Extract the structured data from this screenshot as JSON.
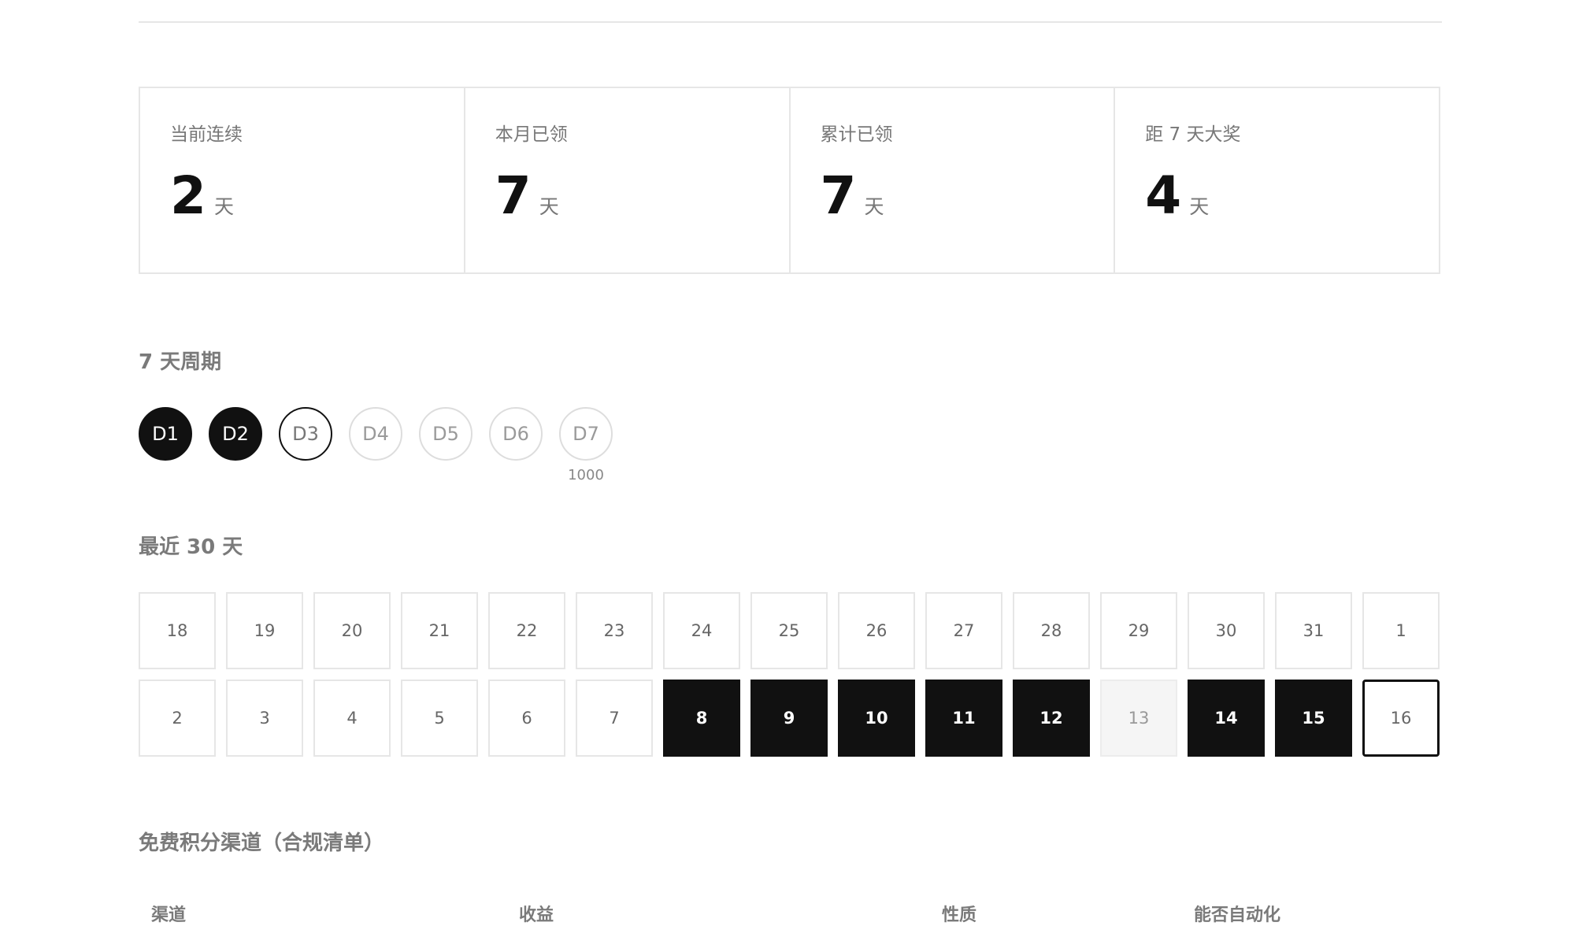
{
  "stats": [
    {
      "label": "当前连续",
      "value": "2",
      "unit": "天"
    },
    {
      "label": "本月已领",
      "value": "7",
      "unit": "天"
    },
    {
      "label": "累计已领",
      "value": "7",
      "unit": "天"
    },
    {
      "label": "距 7 天大奖",
      "value": "4",
      "unit": "天"
    }
  ],
  "cycle": {
    "title": "7 天周期",
    "days": [
      {
        "label": "D1",
        "state": "done",
        "reward": ""
      },
      {
        "label": "D2",
        "state": "done",
        "reward": ""
      },
      {
        "label": "D3",
        "state": "today",
        "reward": ""
      },
      {
        "label": "D4",
        "state": "pending",
        "reward": ""
      },
      {
        "label": "D5",
        "state": "pending",
        "reward": ""
      },
      {
        "label": "D6",
        "state": "pending",
        "reward": ""
      },
      {
        "label": "D7",
        "state": "pending",
        "reward": "1000"
      }
    ]
  },
  "calendar": {
    "title": "最近 30 天",
    "days": [
      {
        "label": "18",
        "state": "empty"
      },
      {
        "label": "19",
        "state": "empty"
      },
      {
        "label": "20",
        "state": "empty"
      },
      {
        "label": "21",
        "state": "empty"
      },
      {
        "label": "22",
        "state": "empty"
      },
      {
        "label": "23",
        "state": "empty"
      },
      {
        "label": "24",
        "state": "empty"
      },
      {
        "label": "25",
        "state": "empty"
      },
      {
        "label": "26",
        "state": "empty"
      },
      {
        "label": "27",
        "state": "empty"
      },
      {
        "label": "28",
        "state": "empty"
      },
      {
        "label": "29",
        "state": "empty"
      },
      {
        "label": "30",
        "state": "empty"
      },
      {
        "label": "31",
        "state": "empty"
      },
      {
        "label": "1",
        "state": "empty"
      },
      {
        "label": "2",
        "state": "empty"
      },
      {
        "label": "3",
        "state": "empty"
      },
      {
        "label": "4",
        "state": "empty"
      },
      {
        "label": "5",
        "state": "empty"
      },
      {
        "label": "6",
        "state": "empty"
      },
      {
        "label": "7",
        "state": "empty"
      },
      {
        "label": "8",
        "state": "checked"
      },
      {
        "label": "9",
        "state": "checked"
      },
      {
        "label": "10",
        "state": "checked"
      },
      {
        "label": "11",
        "state": "checked"
      },
      {
        "label": "12",
        "state": "checked"
      },
      {
        "label": "13",
        "state": "missed"
      },
      {
        "label": "14",
        "state": "checked"
      },
      {
        "label": "15",
        "state": "checked"
      },
      {
        "label": "16",
        "state": "today"
      }
    ]
  },
  "channels": {
    "title": "免费积分渠道（合规清单）",
    "columns": [
      "渠道",
      "收益",
      "性质",
      "能否自动化"
    ]
  },
  "colors": {
    "accent": "#111111",
    "border": "#e6e6e6",
    "muted": "#777777",
    "missed_bg": "#f5f5f5"
  }
}
